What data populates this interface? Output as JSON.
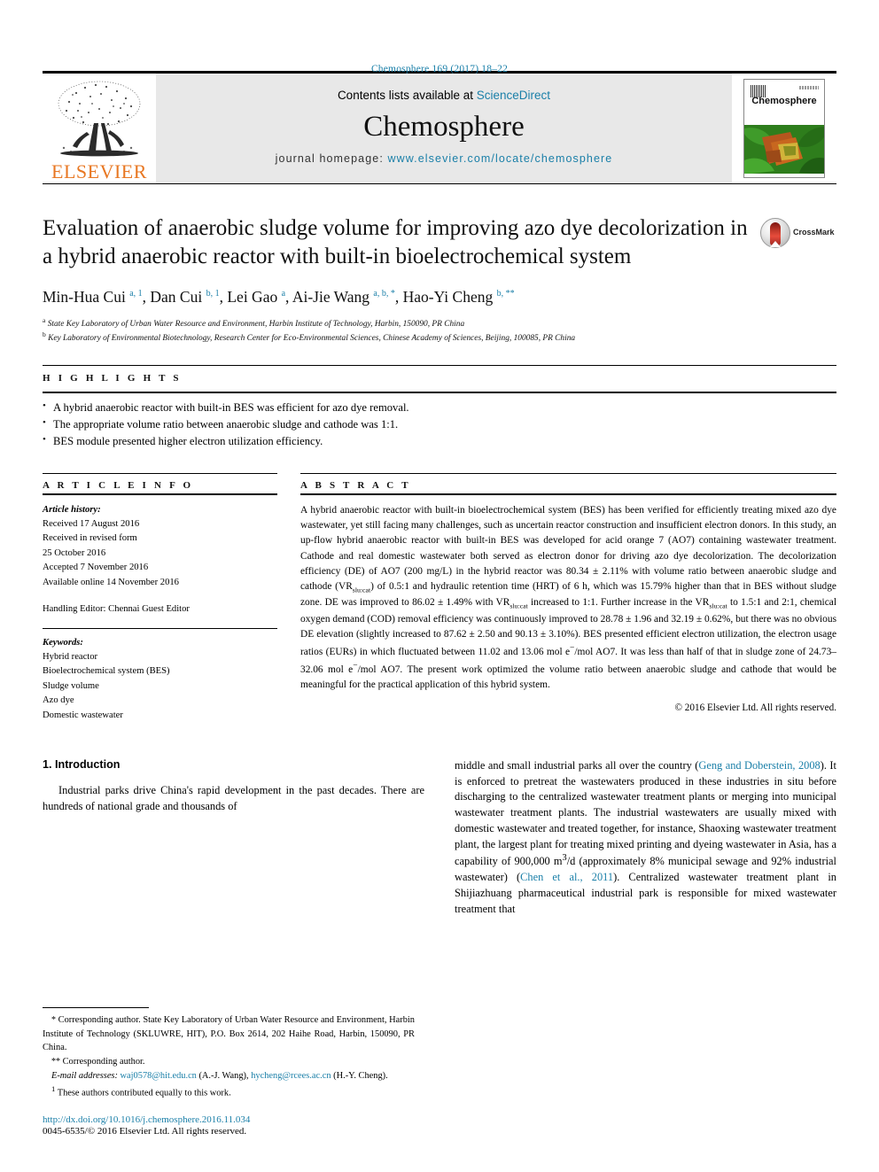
{
  "running_head": "Chemosphere 169 (2017) 18–22",
  "masthead": {
    "publisher_name": "ELSEVIER",
    "contents_prefix": "Contents lists available at ",
    "contents_link": "ScienceDirect",
    "journal_name": "Chemosphere",
    "homepage_prefix": "journal homepage: ",
    "homepage_link": "www.elsevier.com/locate/chemosphere",
    "cover_title": "Chemosphere"
  },
  "article": {
    "title": "Evaluation of anaerobic sludge volume for improving azo dye decolorization in a hybrid anaerobic reactor with built-in bioelectrochemical system",
    "crossmark_label": "CrossMark",
    "authors_html": "Min-Hua Cui <sup>a, 1</sup>, Dan Cui <sup>b, 1</sup>, Lei Gao <sup>a</sup>, Ai-Jie Wang <sup>a, b, *</sup>, Hao-Yi Cheng <sup>b, **</sup>",
    "affiliations": [
      "State Key Laboratory of Urban Water Resource and Environment, Harbin Institute of Technology, Harbin, 150090, PR China",
      "Key Laboratory of Environmental Biotechnology, Research Center for Eco-Environmental Sciences, Chinese Academy of Sciences, Beijing, 100085, PR China"
    ],
    "affiliation_markers": [
      "a",
      "b"
    ]
  },
  "highlights": {
    "heading": "H I G H L I G H T S",
    "items": [
      "A hybrid anaerobic reactor with built-in BES was efficient for azo dye removal.",
      "The appropriate volume ratio between anaerobic sludge and cathode was 1:1.",
      "BES module presented higher electron utilization efficiency."
    ]
  },
  "article_info": {
    "heading": "A R T I C L E  I N F O",
    "history_label": "Article history:",
    "history_lines": [
      "Received 17 August 2016",
      "Received in revised form",
      "25 October 2016",
      "Accepted 7 November 2016",
      "Available online 14 November 2016"
    ],
    "handling_editor": "Handling Editor: Chennai Guest Editor",
    "keywords_label": "Keywords:",
    "keywords": [
      "Hybrid reactor",
      "Bioelectrochemical system (BES)",
      "Sludge volume",
      "Azo dye",
      "Domestic wastewater"
    ]
  },
  "abstract": {
    "heading": "A B S T R A C T",
    "html": "A hybrid anaerobic reactor with built-in bioelectrochemical system (BES) has been verified for efficiently treating mixed azo dye wastewater, yet still facing many challenges, such as uncertain reactor construction and insufficient electron donors. In this study, an up-flow hybrid anaerobic reactor with built-in BES was developed for acid orange 7 (AO7) containing wastewater treatment. Cathode and real domestic wastewater both served as electron donor for driving azo dye decolorization. The decolorization efficiency (DE) of AO7 (200 mg/L) in the hybrid reactor was 80.34 &plusmn; 2.11% with volume ratio between anaerobic sludge and cathode (VR<sub>slu:cat</sub>) of 0.5:1 and hydraulic retention time (HRT) of 6 h, which was 15.79% higher than that in BES without sludge zone. DE was improved to 86.02 &plusmn; 1.49% with VR<sub>slu:cat</sub> increased to 1:1. Further increase in the VR<sub>slu:cat</sub> to 1.5:1 and 2:1, chemical oxygen demand (COD) removal efficiency was continuously improved to 28.78 &plusmn; 1.96 and 32.19 &plusmn; 0.62%, but there was no obvious DE elevation (slightly increased to 87.62 &plusmn; 2.50 and 90.13 &plusmn; 3.10%). BES presented efficient electron utilization, the electron usage ratios (EURs) in which fluctuated between 11.02 and 13.06 mol e<sup>&minus;</sup>/mol AO7. It was less than half of that in sludge zone of 24.73&ndash;32.06 mol e<sup>&minus;</sup>/mol AO7. The present work optimized the volume ratio between anaerobic sludge and cathode that would be meaningful for the practical application of this hybrid system.",
    "copyright": "© 2016 Elsevier Ltd. All rights reserved."
  },
  "introduction": {
    "heading": "1. Introduction",
    "left_paragraph": "Industrial parks drive China's rapid development in the past decades. There are hundreds of national grade and thousands of",
    "right_paragraph_html": "middle and small industrial parks all over the country (<a class=\"cite\" data-name=\"citation-link\" data-interactable=\"true\">Geng and Doberstein, 2008</a>). It is enforced to pretreat the wastewaters produced in these industries in situ before discharging to the centralized wastewater treatment plants or merging into municipal wastewater treatment plants. The industrial wastewaters are usually mixed with domestic wastewater and treated together, for instance, Shaoxing wastewater treatment plant, the largest plant for treating mixed printing and dyeing wastewater in Asia, has a capability of 900,000 m<sup>3</sup>/d (approximately 8% municipal sewage and 92% industrial wastewater) (<a class=\"cite\" data-name=\"citation-link\" data-interactable=\"true\">Chen et al., 2011</a>). Centralized wastewater treatment plant in Shijiazhuang pharmaceutical industrial park is responsible for mixed wastewater treatment that"
  },
  "footnotes": {
    "corresponding_1_html": "<span class=\"marker\">*</span> Corresponding author. State Key Laboratory of Urban Water Resource and Environment, Harbin Institute of Technology (SKLUWRE, HIT), P.O. Box 2614, 202 Haihe Road, Harbin, 150090, PR China.",
    "corresponding_2_html": "<span class=\"marker\">**</span> Corresponding author.",
    "emails_html": "<span class=\"email-lbl\">E-mail addresses:</span> <a data-name=\"email-link-wang\" data-interactable=\"true\">waj0578@hit.edu.cn</a> (A.-J. Wang), <a data-name=\"email-link-cheng\" data-interactable=\"true\">hycheng@rcees.ac.cn</a> (H.-Y. Cheng).",
    "equal_contribution_html": "<sup>1</sup> These authors contributed equally to this work.",
    "doi": "http://dx.doi.org/10.1016/j.chemosphere.2016.11.034",
    "issn_copyright": "0045-6535/© 2016 Elsevier Ltd. All rights reserved."
  },
  "colors": {
    "link": "#1a7fa8",
    "elsevier_orange": "#E87722",
    "masthead_bg": "#e8e8e8"
  }
}
